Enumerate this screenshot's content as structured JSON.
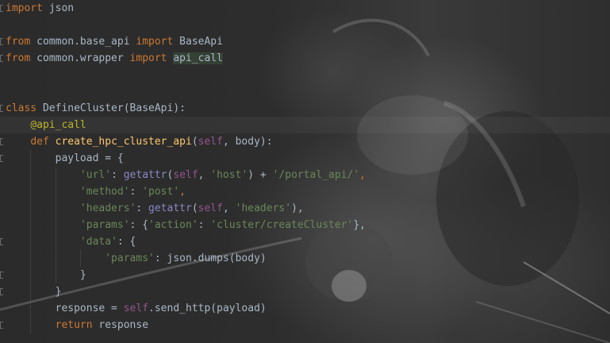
{
  "editor": {
    "lines": [
      [
        {
          "t": "import",
          "c": "kw"
        },
        {
          "t": " json",
          "c": "plain"
        }
      ],
      [],
      [
        {
          "t": "from",
          "c": "kw"
        },
        {
          "t": " common.base_api ",
          "c": "plain"
        },
        {
          "t": "import",
          "c": "kw"
        },
        {
          "t": " BaseApi",
          "c": "plain"
        }
      ],
      [
        {
          "t": "from",
          "c": "kw"
        },
        {
          "t": " common.wrapper ",
          "c": "plain"
        },
        {
          "t": "import",
          "c": "kw"
        },
        {
          "t": " ",
          "c": "plain"
        },
        {
          "t": "api_call",
          "c": "usage"
        }
      ],
      [],
      [],
      [
        {
          "t": "class",
          "c": "kw"
        },
        {
          "t": " DefineCluster(BaseApi):",
          "c": "plain"
        }
      ],
      [
        {
          "t": "    ",
          "c": "plain"
        },
        {
          "t": "@api_call",
          "c": "deco"
        }
      ],
      [
        {
          "t": "    ",
          "c": "plain"
        },
        {
          "t": "def",
          "c": "kw"
        },
        {
          "t": " ",
          "c": "plain"
        },
        {
          "t": "create_hpc_cluster_api",
          "c": "fn"
        },
        {
          "t": "(",
          "c": "plain"
        },
        {
          "t": "self",
          "c": "self"
        },
        {
          "t": ", body):",
          "c": "plain"
        }
      ],
      [
        {
          "t": "        payload = {",
          "c": "plain"
        }
      ],
      [
        {
          "t": "            ",
          "c": "plain"
        },
        {
          "t": "'url'",
          "c": "str"
        },
        {
          "t": ": ",
          "c": "plain"
        },
        {
          "t": "getattr",
          "c": "builtin"
        },
        {
          "t": "(",
          "c": "plain"
        },
        {
          "t": "self",
          "c": "self"
        },
        {
          "t": ", ",
          "c": "plain"
        },
        {
          "t": "'host'",
          "c": "str"
        },
        {
          "t": ") + ",
          "c": "plain"
        },
        {
          "t": "'/portal_api/'",
          "c": "str"
        },
        {
          "t": ",",
          "c": "kw"
        }
      ],
      [
        {
          "t": "            ",
          "c": "plain"
        },
        {
          "t": "'method'",
          "c": "str"
        },
        {
          "t": ": ",
          "c": "plain"
        },
        {
          "t": "'post'",
          "c": "str"
        },
        {
          "t": ",",
          "c": "kw"
        }
      ],
      [
        {
          "t": "            ",
          "c": "plain"
        },
        {
          "t": "'headers'",
          "c": "str"
        },
        {
          "t": ": ",
          "c": "plain"
        },
        {
          "t": "getattr",
          "c": "builtin"
        },
        {
          "t": "(",
          "c": "plain"
        },
        {
          "t": "self",
          "c": "self"
        },
        {
          "t": ", ",
          "c": "plain"
        },
        {
          "t": "'headers'",
          "c": "str"
        },
        {
          "t": "),",
          "c": "plain"
        }
      ],
      [
        {
          "t": "            ",
          "c": "plain"
        },
        {
          "t": "'params'",
          "c": "str"
        },
        {
          "t": ": {",
          "c": "plain"
        },
        {
          "t": "'action'",
          "c": "str"
        },
        {
          "t": ": ",
          "c": "plain"
        },
        {
          "t": "'cluster/createCluster'",
          "c": "str"
        },
        {
          "t": "},",
          "c": "plain"
        }
      ],
      [
        {
          "t": "            ",
          "c": "plain"
        },
        {
          "t": "'data'",
          "c": "str"
        },
        {
          "t": ": {",
          "c": "plain"
        }
      ],
      [
        {
          "t": "                ",
          "c": "plain"
        },
        {
          "t": "'params'",
          "c": "str"
        },
        {
          "t": ": json.dumps(body)",
          "c": "plain"
        }
      ],
      [
        {
          "t": "            }",
          "c": "plain"
        }
      ],
      [
        {
          "t": "        }",
          "c": "plain"
        }
      ],
      [
        {
          "t": "        response = ",
          "c": "plain"
        },
        {
          "t": "self",
          "c": "self"
        },
        {
          "t": ".send_http(payload)",
          "c": "plain"
        }
      ],
      [
        {
          "t": "        ",
          "c": "plain"
        },
        {
          "t": "return",
          "c": "kw"
        },
        {
          "t": " response",
          "c": "plain"
        }
      ]
    ],
    "highlighted_line": 7,
    "fold_markers": [
      0,
      2,
      3,
      6,
      8,
      9,
      14,
      16,
      17,
      19
    ]
  }
}
